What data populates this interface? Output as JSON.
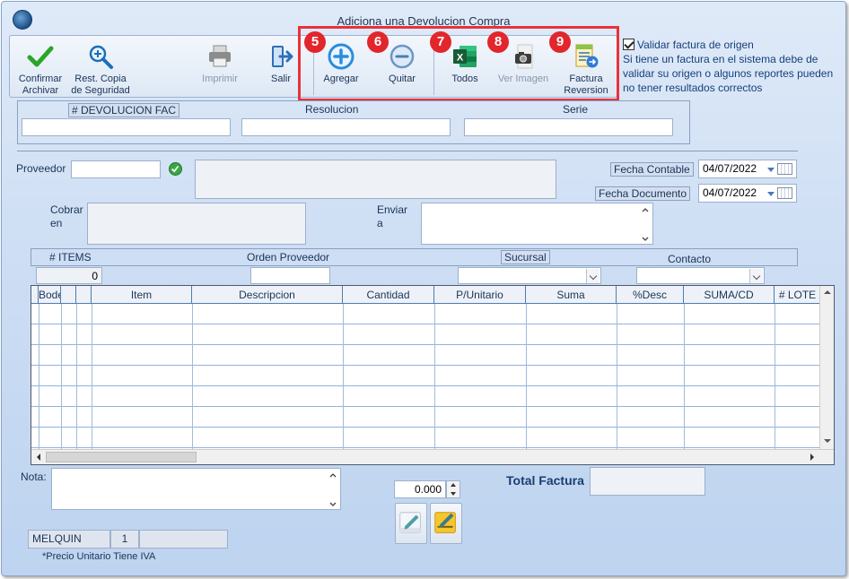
{
  "window": {
    "title": "Adiciona una Devolucion Compra"
  },
  "toolbar": {
    "buttons": [
      {
        "id": "confirmar",
        "label": "Confirmar Archivar",
        "icon": "checkmark-icon"
      },
      {
        "id": "rest",
        "label": "Rest. Copia de Seguridad",
        "icon": "zoom-search-icon"
      },
      {
        "id": "imprimir",
        "label": "Imprimir",
        "icon": "printer-icon"
      },
      {
        "id": "salir",
        "label": "Salir",
        "icon": "exit-door-icon"
      },
      {
        "id": "agregar",
        "label": "Agregar",
        "icon": "plus-circle-icon"
      },
      {
        "id": "quitar",
        "label": "Quitar",
        "icon": "minus-circle-icon"
      },
      {
        "id": "todos",
        "label": "Todos",
        "icon": "excel-icon"
      },
      {
        "id": "ver_imagen",
        "label": "Ver Imagen",
        "icon": "camera-icon"
      },
      {
        "id": "factura_reversion",
        "label": "Factura Reversion",
        "icon": "document-reversion-icon"
      }
    ],
    "badges": [
      "5",
      "6",
      "7",
      "8",
      "9"
    ]
  },
  "validar": {
    "label": "Validar factura de origen",
    "checked": true,
    "note": "Si tiene un factura en el sistema debe de validar su origen o algunos reportes pueden no tener resultados correctos"
  },
  "header_fields": {
    "devolucion_label": "# DEVOLUCION FAC",
    "devolucion_value": "",
    "resolucion_label": "Resolucion",
    "resolucion_value": "",
    "serie_label": "Serie",
    "serie_value": ""
  },
  "proveedor": {
    "label": "Proveedor",
    "code": "",
    "name": ""
  },
  "fecha_contable": {
    "label": "Fecha Contable",
    "value": "04/07/2022"
  },
  "fecha_documento": {
    "label": "Fecha Documento",
    "value": "04/07/2022"
  },
  "cobrar_en": {
    "label1": "Cobrar",
    "label2": "en",
    "value": ""
  },
  "enviar_a": {
    "label1": "Enviar",
    "label2": "a",
    "value": ""
  },
  "items_bar": {
    "items_label": "# ITEMS",
    "items_value": "0",
    "orden_label": "Orden Proveedor",
    "orden_value": "",
    "sucursal_label": "Sucursal",
    "sucursal_value": "",
    "contacto_label": "Contacto",
    "contacto_value": ""
  },
  "grid": {
    "columns": [
      "Bodega",
      "",
      "Item",
      "Descripcion",
      "Cantidad",
      "P/Unitario",
      "Suma",
      "%Desc",
      "SUMA/CD",
      "# LOTE"
    ],
    "row_count": 7
  },
  "nota": {
    "label": "Nota:",
    "value": ""
  },
  "spinner_value": "0.000",
  "total": {
    "label": "Total Factura",
    "value": ""
  },
  "status": {
    "user": "MELQUIN",
    "number": "1",
    "extra": ""
  },
  "footnote": "*Precio Unitario Tiene IVA",
  "colors": {
    "badge": "#e2262b",
    "highlight": "#e8323a",
    "grid_line": "#4d7ab5"
  }
}
